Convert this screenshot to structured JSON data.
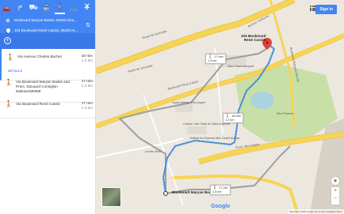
{
  "panel": {
    "modes": [
      {
        "icon": "car-icon",
        "glyph": "🚗"
      },
      {
        "icon": "directions-icon",
        "glyph": "↱"
      },
      {
        "icon": "car-icon",
        "glyph": "⛟"
      },
      {
        "icon": "transit-icon",
        "glyph": "🚆"
      },
      {
        "icon": "walking-icon",
        "glyph": "🚶"
      },
      {
        "icon": "bicycle-icon",
        "glyph": "🚲"
      },
      {
        "icon": "flight-icon",
        "glyph": "✈"
      }
    ],
    "origin": "Boulevard Maryse Bastié, 06200 Nice,...",
    "destination": "104 Boulevard René Cassin, 06200 Ni...",
    "routes": [
      {
        "via": "Via Avenue Charles Buchet",
        "time": "16 min",
        "dist": "1.2 km",
        "details": "DETAILS"
      },
      {
        "via": "Via Boulevard Maryse Bastié and Prom. Edouard Corniglion Molinier/M6098",
        "time": "17 min",
        "dist": "1.3 km"
      },
      {
        "via": "Via Boulevard René Cassin",
        "time": "17 min",
        "dist": "1.3 km"
      }
    ]
  },
  "map": {
    "signin": "Sign in",
    "destination_label": "104 Boulevard\nRené Cassin",
    "origin_label": "Boulevard Maryse Bastié",
    "callouts": [
      {
        "time": "17 min",
        "dist": "1.3 km"
      },
      {
        "time": "16 min",
        "dist": "1.2 km"
      },
      {
        "time": "17 min",
        "dist": "1.3 km"
      }
    ],
    "streets": [
      "Route de Grenoble",
      "Boulevard René Cassin",
      "Prom. des Anglais",
      "Avenue Californie",
      "Boulevard Édouard Herriot",
      "Route de Grenoble"
    ],
    "places": [
      "Nice Chave Aéroport",
      "Lycée Hôtelier Paul Augier",
      "Cuisine Clair Sassi de Saint-Augustin",
      "Holiday Inn Express Nice Grand Arénas",
      "Leclerc Nice",
      "Parc Phoenix"
    ],
    "google": "Google",
    "footer": "Map data ©2016 Google   Terms   Send feedback   100 m"
  },
  "colors": {
    "blue": "#4285f4",
    "route": "#4a90d9",
    "alt": "#9e9e9e",
    "highway": "#f7d455",
    "park": "#c9dfa8",
    "water": "#aad3df"
  }
}
